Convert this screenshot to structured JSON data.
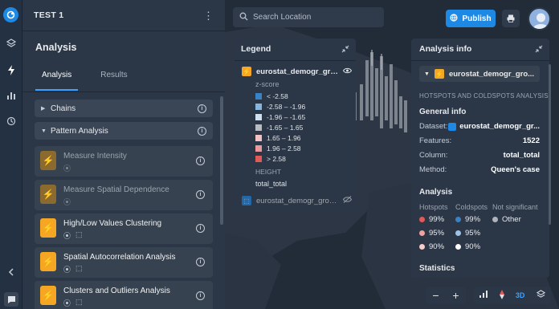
{
  "project": {
    "title": "TEST 1"
  },
  "sidebar": {
    "heading": "Analysis",
    "tabs": [
      "Analysis",
      "Results"
    ]
  },
  "sections": [
    {
      "label": "Chains",
      "expanded": false
    },
    {
      "label": "Pattern Analysis",
      "expanded": true
    }
  ],
  "analyses": [
    {
      "label": "Measure Intensity",
      "enabled": false
    },
    {
      "label": "Measure Spatial Dependence",
      "enabled": false
    },
    {
      "label": "High/Low Values Clustering",
      "enabled": true
    },
    {
      "label": "Spatial Autocorrelation Analysis",
      "enabled": true
    },
    {
      "label": "Clusters and Outliers Analysis",
      "enabled": true
    }
  ],
  "search": {
    "placeholder": "Search Location"
  },
  "header": {
    "publish_label": "Publish"
  },
  "legend": {
    "title": "Legend",
    "layer_name": "eurostat_demogr_grou...",
    "zscore_label": "z-score",
    "items": [
      {
        "label": "< -2.58",
        "color": "#3b82c4"
      },
      {
        "label": "-2.58 – -1.96",
        "color": "#86b5e0"
      },
      {
        "label": "-1.96 – -1.65",
        "color": "#cfe0f0"
      },
      {
        "label": "-1.65 – 1.65",
        "color": "#b8bcc2"
      },
      {
        "label": "1.65 – 1.96",
        "color": "#f2c2c2"
      },
      {
        "label": "1.96 – 2.58",
        "color": "#ea9a9a"
      },
      {
        "label": "> 2.58",
        "color": "#e05a5a"
      }
    ],
    "height_label": "HEIGHT",
    "height_value": "total_total",
    "layer2_name": "eurostat_demogr_grou..."
  },
  "info": {
    "title": "Analysis info",
    "layer": "eurostat_demogr_gro...",
    "caption": "HOTSPOTS AND COLDSPOTS ANALYSIS",
    "general_heading": "General info",
    "dataset_key": "Dataset:",
    "dataset_val": "eurostat_demogr_gr...",
    "features_key": "Features:",
    "features_val": "1522",
    "column_key": "Column:",
    "column_val": "total_total",
    "method_key": "Method:",
    "method_val": "Queen's case",
    "analysis_heading": "Analysis",
    "col_hot": "Hotspots",
    "col_cold": "Coldspots",
    "col_ns": "Not significant",
    "hot": [
      "99%",
      "95%",
      "90%"
    ],
    "cold": [
      "99%",
      "95%",
      "90%"
    ],
    "ns_label": "Other",
    "hot_colors": [
      "#e05a5a",
      "#f2a0a0",
      "#f7cccc"
    ],
    "cold_colors": [
      "#3b82c4",
      "#9cc3e8",
      "#ffffff"
    ],
    "ns_color": "#b0b4ba",
    "stats_heading": "Statistics"
  },
  "map_controls": {
    "zoom_out": "−",
    "zoom_in": "+",
    "mode": "3D"
  }
}
